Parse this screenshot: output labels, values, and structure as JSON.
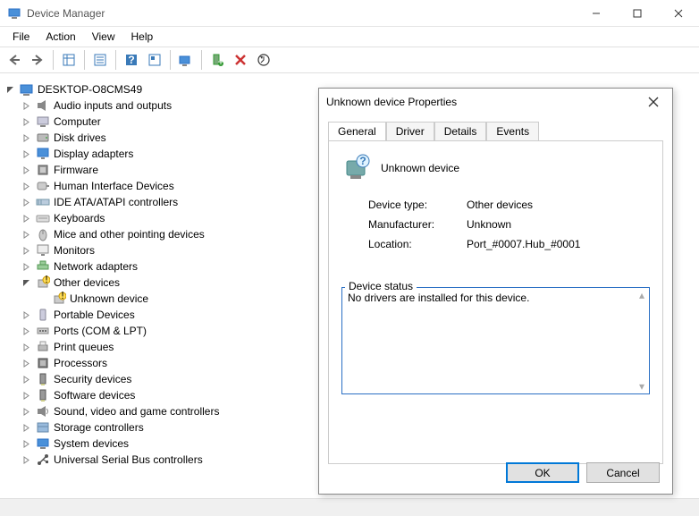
{
  "window": {
    "title": "Device Manager"
  },
  "menu": {
    "file": "File",
    "action": "Action",
    "view": "View",
    "help": "Help"
  },
  "tree": {
    "root": "DESKTOP-O8CMS49",
    "items": [
      {
        "label": "Audio inputs and outputs",
        "icon": "speaker"
      },
      {
        "label": "Computer",
        "icon": "computer"
      },
      {
        "label": "Disk drives",
        "icon": "disk"
      },
      {
        "label": "Display adapters",
        "icon": "display"
      },
      {
        "label": "Firmware",
        "icon": "chip"
      },
      {
        "label": "Human Interface Devices",
        "icon": "hid"
      },
      {
        "label": "IDE ATA/ATAPI controllers",
        "icon": "ide"
      },
      {
        "label": "Keyboards",
        "icon": "keyboard"
      },
      {
        "label": "Mice and other pointing devices",
        "icon": "mouse"
      },
      {
        "label": "Monitors",
        "icon": "monitor"
      },
      {
        "label": "Network adapters",
        "icon": "network"
      },
      {
        "label": "Other devices",
        "icon": "other",
        "expanded": true,
        "children": [
          {
            "label": "Unknown device",
            "icon": "unknown"
          }
        ]
      },
      {
        "label": "Portable Devices",
        "icon": "portable"
      },
      {
        "label": "Ports (COM & LPT)",
        "icon": "port"
      },
      {
        "label": "Print queues",
        "icon": "printer"
      },
      {
        "label": "Processors",
        "icon": "cpu"
      },
      {
        "label": "Security devices",
        "icon": "security"
      },
      {
        "label": "Software devices",
        "icon": "software"
      },
      {
        "label": "Sound, video and game controllers",
        "icon": "sound"
      },
      {
        "label": "Storage controllers",
        "icon": "storage"
      },
      {
        "label": "System devices",
        "icon": "system"
      },
      {
        "label": "Universal Serial Bus controllers",
        "icon": "usb"
      }
    ]
  },
  "dialog": {
    "title": "Unknown device Properties",
    "tabs": {
      "general": "General",
      "driver": "Driver",
      "details": "Details",
      "events": "Events"
    },
    "device_name": "Unknown device",
    "props": {
      "device_type_k": "Device type:",
      "device_type_v": "Other devices",
      "manufacturer_k": "Manufacturer:",
      "manufacturer_v": "Unknown",
      "location_k": "Location:",
      "location_v": "Port_#0007.Hub_#0001"
    },
    "status_label": "Device status",
    "status_text": "No drivers are installed for this device.",
    "ok": "OK",
    "cancel": "Cancel"
  }
}
